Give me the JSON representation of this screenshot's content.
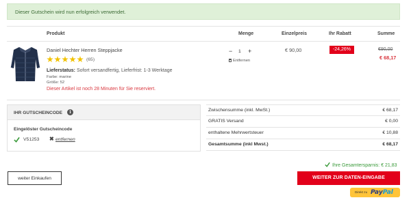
{
  "banner": {
    "message": "Dieser Gutschein wird nun erfolgreich verwendet."
  },
  "colors": {
    "accent": "#e2001a",
    "success_bg": "#dff0d8",
    "success_text": "#3c6b35",
    "star": "#f2c200",
    "savings": "#3a9a3a"
  },
  "table_header": {
    "product": "Produkt",
    "quantity": "Menge",
    "unit_price": "Einzelpreis",
    "discount": "Ihr Rabatt",
    "total": "Summe"
  },
  "product": {
    "image_icon": "jacket-image",
    "name": "Daniel Hechter Herren Steppjacke",
    "rating_stars": 5,
    "rating_count": "(65)",
    "status_label": "Lieferstatus:",
    "status_value": "Sofort versandfertig, Lieferfrist: 1-3 Werktage",
    "color_line": "Farbe: marine",
    "size_line": "Größe: 52",
    "reserve_note": "Dieser Artikel ist noch 28 Minuten für Sie reserviert.",
    "qty_minus": "−",
    "qty_value": "1",
    "qty_plus": "+",
    "remove_label": "Entfernen",
    "unit_price": "€ 90,00",
    "discount": "-24,26%",
    "old_price": "€90,00",
    "new_price": "€ 68,17"
  },
  "voucher": {
    "title": "IHR GUTSCHEINCODE",
    "info_icon": "info-icon",
    "redeemed_label": "Eingelöster Gutscheincode",
    "code": "V51253",
    "remove_label": "entfernen"
  },
  "summary": [
    {
      "label": "Zwischensumme (inkl. MwSt.)",
      "value": "€ 68,17",
      "bold": false
    },
    {
      "label": "GRATIS Versand",
      "value": "€ 0,00",
      "bold": false
    },
    {
      "label": "enthaltene Mehrwertsteuer",
      "value": "€ 10,88",
      "bold": false
    },
    {
      "label": "Gesamtsumme (inkl Mwst.)",
      "value": "€ 68,17",
      "bold": true
    }
  ],
  "savings": "Ihre Gesamtersparnis: € 21,83",
  "buttons": {
    "continue": "weiter Einkaufen",
    "checkout": "WEITER ZUR DATEN-EINGABE",
    "paypal_direct": "Direkt zu",
    "paypal_pay": "Pay",
    "paypal_pal": "Pal"
  }
}
